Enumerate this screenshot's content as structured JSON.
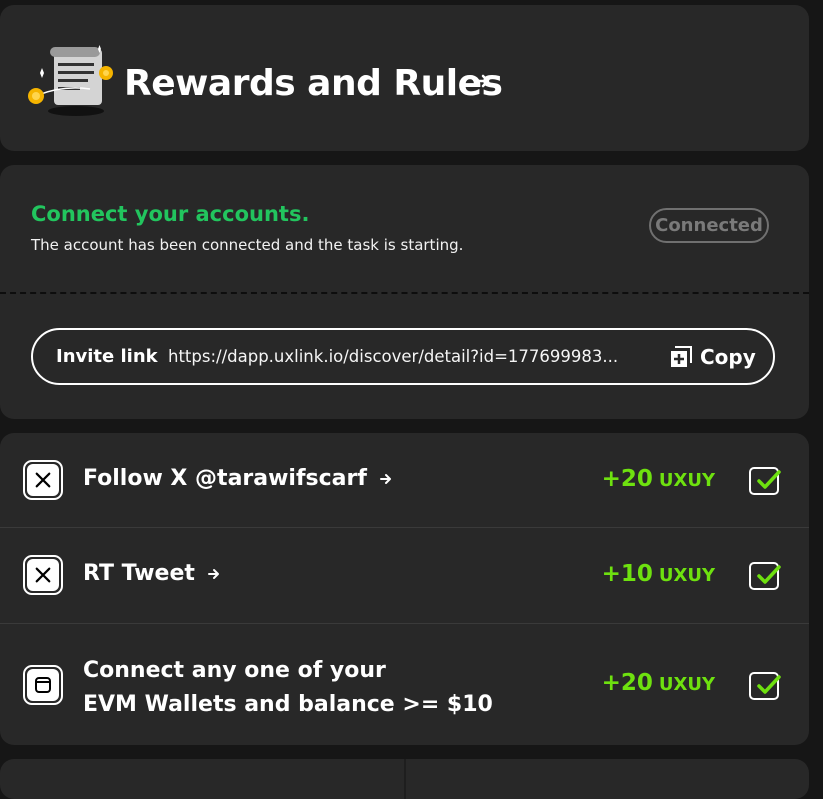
{
  "header": {
    "title": "Rewards and Rules",
    "illustration_icon": "scroll-document-coins-icon",
    "arrow_icon": "arrow-right-icon"
  },
  "connect": {
    "title": "Connect your accounts.",
    "description": "The account has been connected and the task is starting.",
    "status_button": "Connected",
    "title_color": "#22c55e"
  },
  "invite": {
    "label": "Invite link",
    "url": "https://dapp.uxlink.io/discover/detail?id=177699983...",
    "copy_label": "Copy",
    "copy_icon": "copy-plus-icon"
  },
  "tasks": [
    {
      "icon": "x-logo-icon",
      "label": "Follow X @tarawifscarf",
      "points": "+20",
      "unit": "UXUY",
      "completed": true
    },
    {
      "icon": "x-logo-icon",
      "label": "RT Tweet",
      "points": "+10",
      "unit": "UXUY",
      "completed": true
    },
    {
      "icon": "wallet-icon",
      "label_line1": "Connect any one of your",
      "label_line2": "EVM Wallets and balance >= $10",
      "points": "+20",
      "unit": "UXUY",
      "completed": true
    }
  ],
  "colors": {
    "accent_green": "#6ee10f",
    "card_bg": "#282828",
    "page_bg": "#161616"
  }
}
